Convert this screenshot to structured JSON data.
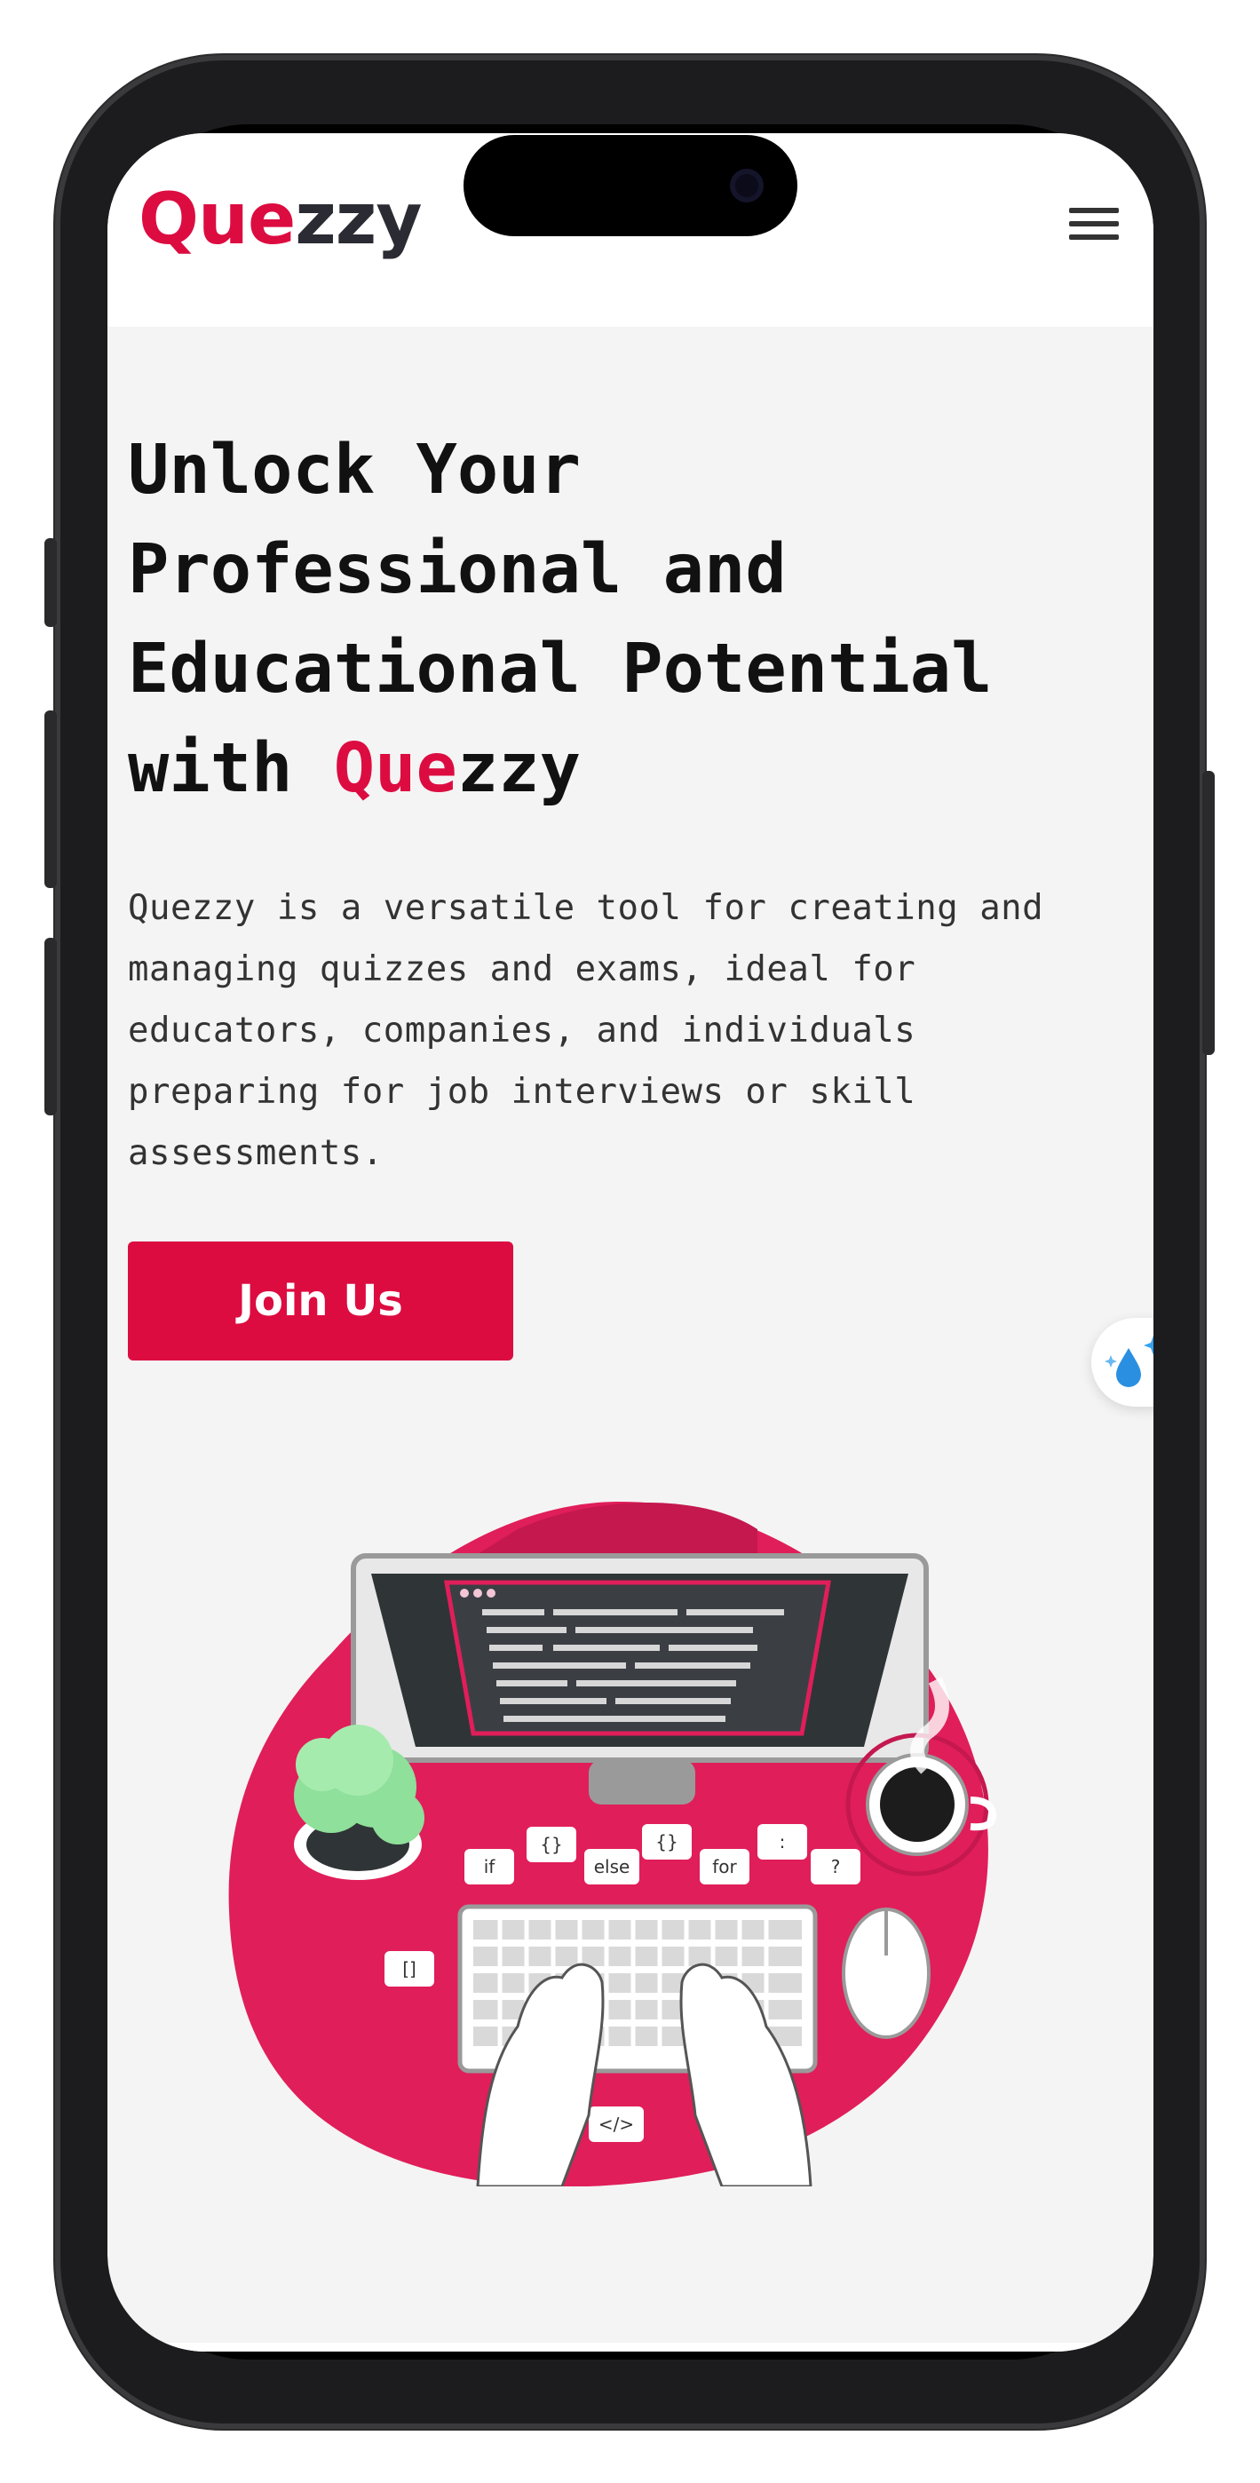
{
  "brand": {
    "logo_accent": "Que",
    "logo_rest": "zzy",
    "accent_color": "#dc0c41"
  },
  "header": {
    "menu_icon": "hamburger-menu-icon"
  },
  "hero": {
    "title_lines": [
      "Unlock Your",
      "Professional and",
      "Educational Potential"
    ],
    "title_last_prefix": "with ",
    "title_brand_accent": "Que",
    "title_brand_rest": "zzy",
    "description_lines": [
      "Quezzy is a versatile tool for creating and",
      "managing quizzes and exams, ideal for",
      "educators, companies, and individuals",
      "preparing for job interviews or skill",
      "assessments."
    ],
    "cta_label": "Join Us"
  },
  "floating_widget": {
    "icon": "sparkle-drop-icon"
  },
  "illustration": {
    "icon": "coding-desk-illustration",
    "bubble_labels": [
      "if",
      "{}",
      "else",
      "{}",
      "for",
      ":",
      "?",
      "[]",
      "</>"
    ]
  }
}
